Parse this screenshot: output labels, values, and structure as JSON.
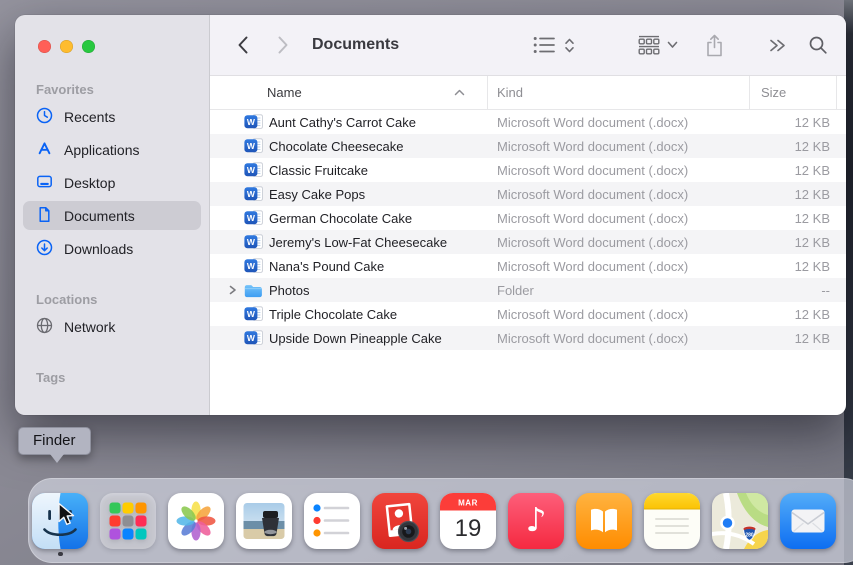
{
  "window": {
    "controls": {
      "close": "red",
      "minimize": "yellow",
      "zoom": "green"
    },
    "sidebar": {
      "sections": [
        {
          "label": "Favorites",
          "items": [
            {
              "label": "Recents",
              "icon": "clock-icon",
              "selected": false
            },
            {
              "label": "Applications",
              "icon": "app-store-a-icon",
              "selected": false
            },
            {
              "label": "Desktop",
              "icon": "desktop-window-icon",
              "selected": false
            },
            {
              "label": "Documents",
              "icon": "document-page-icon",
              "selected": true
            },
            {
              "label": "Downloads",
              "icon": "download-circle-icon",
              "selected": false
            }
          ]
        },
        {
          "label": "Locations",
          "items": [
            {
              "label": "Network",
              "icon": "globe-icon",
              "selected": false
            }
          ]
        },
        {
          "label": "Tags",
          "items": []
        }
      ]
    },
    "toolbar": {
      "title": "Documents",
      "icons": [
        "chevron-back",
        "chevron-forward",
        "list-view",
        "sort-updown",
        "group-grid",
        "chevron-down",
        "share",
        "more-chevrons",
        "search"
      ]
    },
    "list": {
      "columns": [
        {
          "label": "Name",
          "sort": "ascending"
        },
        {
          "label": "Kind"
        },
        {
          "label": "Size"
        }
      ],
      "files": [
        {
          "name": "Aunt Cathy's Carrot Cake",
          "kind": "Microsoft Word document (.docx)",
          "size": "12 KB",
          "icon": "word-doc-icon"
        },
        {
          "name": "Chocolate Cheesecake",
          "kind": "Microsoft Word document (.docx)",
          "size": "12 KB",
          "icon": "word-doc-icon"
        },
        {
          "name": "Classic Fruitcake",
          "kind": "Microsoft Word document (.docx)",
          "size": "12 KB",
          "icon": "word-doc-icon"
        },
        {
          "name": "Easy Cake Pops",
          "kind": "Microsoft Word document (.docx)",
          "size": "12 KB",
          "icon": "word-doc-icon"
        },
        {
          "name": "German Chocolate Cake",
          "kind": "Microsoft Word document (.docx)",
          "size": "12 KB",
          "icon": "word-doc-icon"
        },
        {
          "name": "Jeremy's Low-Fat Cheesecake",
          "kind": "Microsoft Word document (.docx)",
          "size": "12 KB",
          "icon": "word-doc-icon"
        },
        {
          "name": "Nana's Pound Cake",
          "kind": "Microsoft Word document (.docx)",
          "size": "12 KB",
          "icon": "word-doc-icon"
        },
        {
          "name": "Photos",
          "kind": "Folder",
          "size": "--",
          "icon": "folder-icon",
          "expandable": true
        },
        {
          "name": "Triple Chocolate Cake",
          "kind": "Microsoft Word document (.docx)",
          "size": "12 KB",
          "icon": "word-doc-icon"
        },
        {
          "name": "Upside Down Pineapple Cake",
          "kind": "Microsoft Word document (.docx)",
          "size": "12 KB",
          "icon": "word-doc-icon"
        }
      ]
    }
  },
  "tooltip": {
    "label": "Finder"
  },
  "dock": {
    "apps": [
      "finder",
      "launchpad",
      "photos",
      "preview",
      "reminders",
      "photo-booth",
      "calendar",
      "music",
      "books",
      "notes",
      "maps",
      "mail"
    ],
    "running_app": "finder",
    "calendar": {
      "month": "MAR",
      "day": "19"
    },
    "maps_shield": "280",
    "music_note_glyph": "♪"
  },
  "file_icons": {
    "word_badge": "W"
  },
  "colors": {
    "accent_blue": "#0a63f5",
    "sidebar_bg": "#e3e2e8",
    "toolbar_bg": "#f3f2f7",
    "selection_gray": "#cdccd3",
    "row_alt": "#f4f4f6",
    "tooltip_bg": "#b2b4c1",
    "dock_bg": "rgba(203,205,217,0.74)",
    "traffic_red": "#ff5f57",
    "traffic_yellow": "#febc2e",
    "traffic_green": "#28c840"
  }
}
